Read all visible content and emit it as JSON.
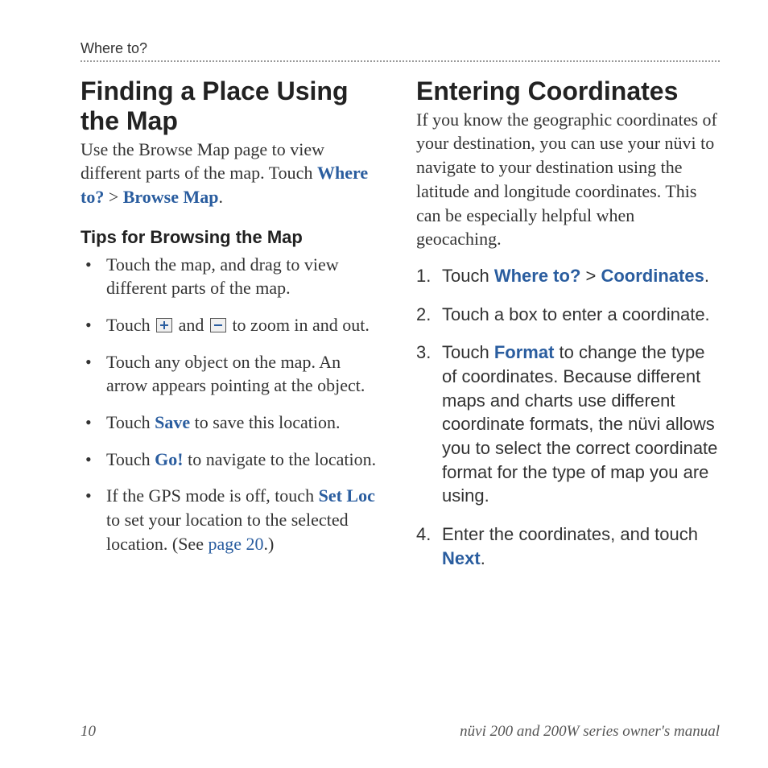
{
  "header": {
    "section_label": "Where to?"
  },
  "left": {
    "title": "Finding a Place Using the Map",
    "intro_pre": "Use the Browse Map page to view different parts of the map. Touch ",
    "intro_kw1": "Where to?",
    "intro_sep": " > ",
    "intro_kw2": "Browse Map",
    "intro_post": ".",
    "subhead": "Tips for Browsing the Map",
    "tips": {
      "t1": "Touch the map, and drag to view different parts of the map.",
      "t2_pre": "Touch ",
      "t2_mid": " and ",
      "t2_post": " to zoom in and out.",
      "t3": "Touch any object on the map. An arrow appears pointing at the object.",
      "t4_pre": "Touch ",
      "t4_kw": "Save",
      "t4_post": " to save this location.",
      "t5_pre": "Touch ",
      "t5_kw": "Go!",
      "t5_post": " to navigate to the location.",
      "t6_pre": "If the GPS mode is off, touch ",
      "t6_kw": "Set Loc",
      "t6_mid": " to set your location to the selected location. (See ",
      "t6_link": "page 20",
      "t6_post": ".)"
    }
  },
  "right": {
    "title": "Entering Coordinates",
    "intro": "If you know the geographic coordinates of your destination, you can use your nüvi to navigate to your destination using the latitude and longitude coordinates. This can be especially helpful when geocaching.",
    "steps": {
      "s1_pre": "Touch ",
      "s1_kw1": "Where to?",
      "s1_sep": " > ",
      "s1_kw2": "Coordinates",
      "s1_post": ".",
      "s2": "Touch a box to enter a coordinate.",
      "s3_pre": "Touch ",
      "s3_kw": "Format",
      "s3_post": " to change the type of coordinates. Because different maps and charts use different coordinate formats, the nüvi allows you to select the correct coordinate format for the type of map you are using.",
      "s4_pre": "Enter the coordinates, and touch ",
      "s4_kw": "Next",
      "s4_post": "."
    }
  },
  "footer": {
    "page_number": "10",
    "manual_title": "nüvi 200 and 200W series owner's manual"
  }
}
